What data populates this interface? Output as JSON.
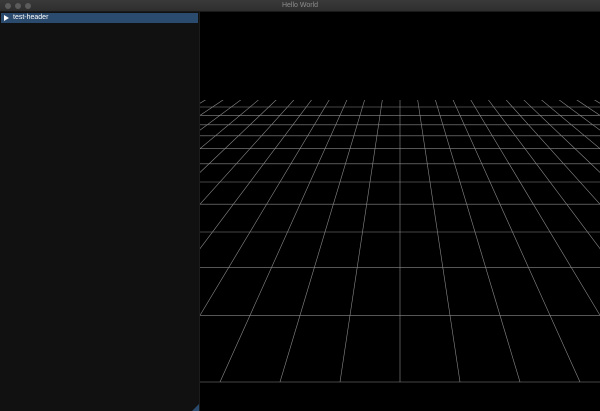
{
  "window": {
    "title": "Hello World"
  },
  "sidebar": {
    "header": {
      "label": "test-header",
      "expanded": false
    }
  },
  "viewport": {
    "background_color": "#000000",
    "grid_color": "#8a8a8a"
  },
  "colors": {
    "header_highlight": "#2a4a6e",
    "sidebar_background": "#111111"
  }
}
